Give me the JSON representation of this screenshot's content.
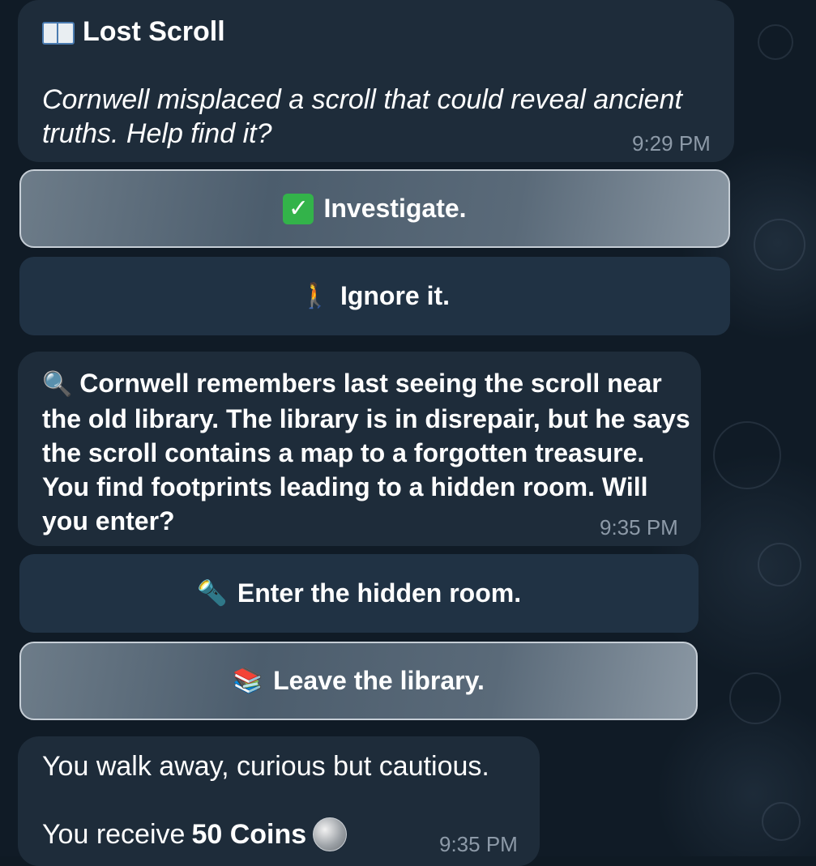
{
  "messages": [
    {
      "title": "Lost Scroll",
      "title_icon": "open-book-icon",
      "text": "Cornwell misplaced a scroll that could reveal ancient truths. Help find it?",
      "time": "9:29 PM",
      "buttons": [
        {
          "label": "Investigate.",
          "icon": "check-mark-icon",
          "selected": true
        },
        {
          "label": "Ignore it.",
          "icon": "walking-person-icon",
          "selected": false
        }
      ]
    },
    {
      "icon": "magnifying-glass-icon",
      "text": "Cornwell remembers last seeing the scroll near the old library. The library is in disrepair, but he says the scroll contains a map to a forgotten treasure. You find footprints leading to a hidden room. Will you enter?",
      "time": "9:35 PM",
      "buttons": [
        {
          "label": "Enter the hidden room.",
          "icon": "flashlight-icon",
          "selected": false
        },
        {
          "label": "Leave the library.",
          "icon": "books-icon",
          "selected": true
        }
      ]
    },
    {
      "line1": "You walk away, curious but cautious.",
      "line2_prefix": "You receive",
      "line2_bold": "50 Coins",
      "reward_icon": "coin-icon",
      "time": "9:35 PM"
    }
  ],
  "colors": {
    "background": "#101b26",
    "bubble": "#1e2c3a",
    "button": "#203244",
    "text": "#ffffff",
    "timestamp": "#8d9aa8"
  }
}
